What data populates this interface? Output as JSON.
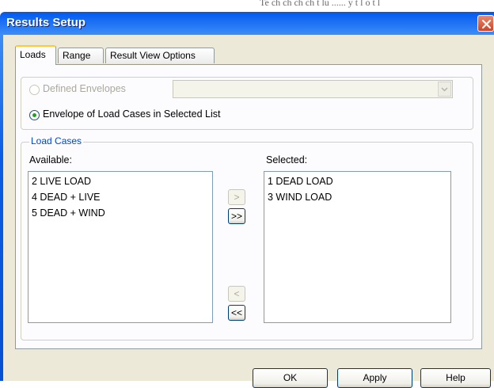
{
  "overflow_text": "Te ch ch ch ch t lu ...... y t l o t l",
  "window": {
    "title": "Results Setup"
  },
  "tabs": [
    {
      "label": "Loads"
    },
    {
      "label": "Range"
    },
    {
      "label": "Result View Options"
    }
  ],
  "envelope": {
    "defined_label": "Defined Envelopes",
    "defined_selected": false,
    "defined_enabled": false,
    "combo_value": "",
    "selected_list_label": "Envelope of Load Cases in Selected List",
    "selected_list_selected": true
  },
  "load_cases": {
    "group_label": "Load Cases",
    "available_label": "Available:",
    "available_items": [
      "2 LIVE LOAD",
      "4 DEAD + LIVE",
      "5 DEAD + WIND"
    ],
    "selected_label": "Selected:",
    "selected_items": [
      "1 DEAD LOAD",
      "3 WIND LOAD"
    ],
    "add_one": ">",
    "add_all": ">>",
    "remove_one": "<",
    "remove_all": "<<"
  },
  "footer": {
    "ok": "OK",
    "apply": "Apply",
    "help": "Help"
  },
  "colors": {
    "title_bar": "#0a5ce6",
    "panel": "#ece9d8",
    "group_label": "#0046d5",
    "radio_dot": "#21a121"
  },
  "icons": [
    "close-icon",
    "chevron-down-icon"
  ]
}
